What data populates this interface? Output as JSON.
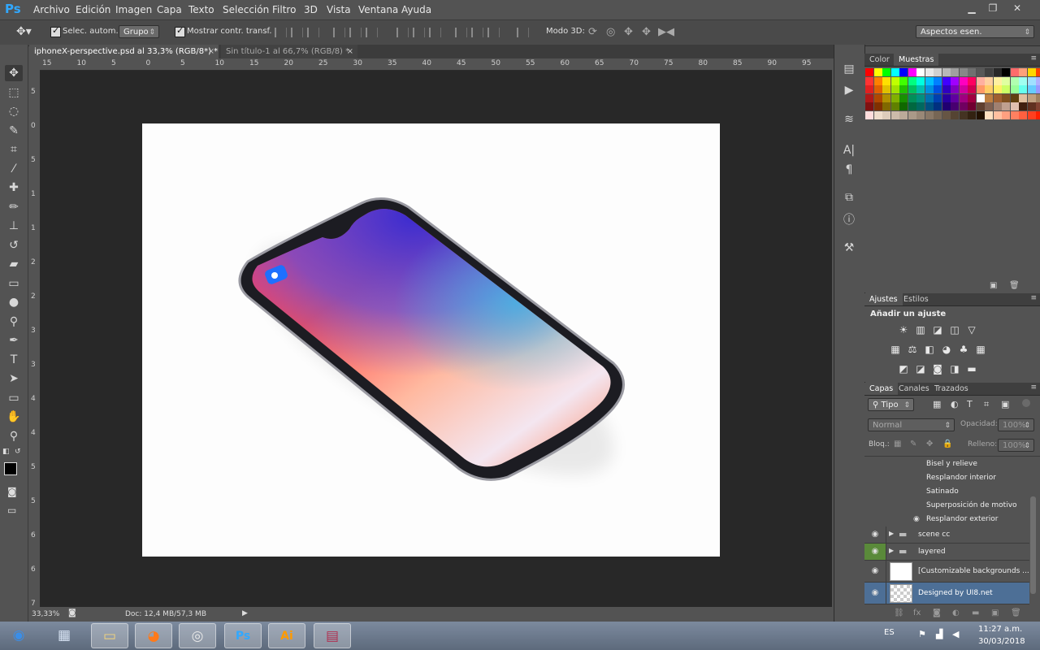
{
  "app": {
    "logo": "Ps"
  },
  "menu": [
    "Archivo",
    "Edición",
    "Imagen",
    "Capa",
    "Texto",
    "Selección",
    "Filtro",
    "3D",
    "Vista",
    "Ventana",
    "Ayuda"
  ],
  "window_controls": {
    "minimize": "▁",
    "restore": "❐",
    "close": "✕"
  },
  "options_bar": {
    "auto_select_label": "Selec. autom.:",
    "auto_select_value": "Grupo",
    "show_transform_label": "Mostrar contr. transf.",
    "mode3d_label": "Modo 3D:",
    "workspace_value": "Aspectos esen."
  },
  "tabs": [
    {
      "label": "iphoneX-perspective.psd al 33,3% (RGB/8*) *",
      "active": true
    },
    {
      "label": "Sin título-1 al 66,7% (RGB/8) *",
      "active": false
    }
  ],
  "ruler_h": [
    "15",
    "10",
    "5",
    "0",
    "5",
    "10",
    "15",
    "20",
    "25",
    "30",
    "35",
    "40",
    "45",
    "50",
    "55",
    "60",
    "65",
    "70",
    "75",
    "80",
    "85",
    "90",
    "95"
  ],
  "ruler_v": [
    "5",
    "0",
    "5",
    "1",
    "1",
    "2",
    "2",
    "3",
    "3",
    "4",
    "4",
    "5",
    "5",
    "6",
    "6",
    "7"
  ],
  "status": {
    "zoom": "33,33%",
    "doc": "Doc: 12,4 MB/57,3 MB"
  },
  "tools": [
    {
      "name": "move-tool-icon",
      "glyph": "✥"
    },
    {
      "name": "marquee-tool-icon",
      "glyph": "⬚"
    },
    {
      "name": "lasso-tool-icon",
      "glyph": "◌"
    },
    {
      "name": "quick-selection-tool-icon",
      "glyph": "✎"
    },
    {
      "name": "crop-tool-icon",
      "glyph": "⌗"
    },
    {
      "name": "eyedropper-tool-icon",
      "glyph": "⁄"
    },
    {
      "name": "healing-brush-tool-icon",
      "glyph": "✚"
    },
    {
      "name": "brush-tool-icon",
      "glyph": "✏"
    },
    {
      "name": "clone-stamp-tool-icon",
      "glyph": "⊥"
    },
    {
      "name": "history-brush-tool-icon",
      "glyph": "↺"
    },
    {
      "name": "eraser-tool-icon",
      "glyph": "▰"
    },
    {
      "name": "gradient-tool-icon",
      "glyph": "▭"
    },
    {
      "name": "blur-tool-icon",
      "glyph": "●"
    },
    {
      "name": "dodge-tool-icon",
      "glyph": "⚲"
    },
    {
      "name": "pen-tool-icon",
      "glyph": "✒"
    },
    {
      "name": "type-tool-icon",
      "glyph": "T"
    },
    {
      "name": "path-selection-tool-icon",
      "glyph": "➤"
    },
    {
      "name": "rectangle-tool-icon",
      "glyph": "▭"
    },
    {
      "name": "hand-tool-icon",
      "glyph": "✋"
    },
    {
      "name": "zoom-tool-icon",
      "glyph": "⚲"
    }
  ],
  "dock_icons": [
    {
      "name": "history-panel-icon",
      "glyph": "▤"
    },
    {
      "name": "actions-panel-icon",
      "glyph": "▶"
    },
    {
      "name": "brush-settings-icon",
      "glyph": "≋"
    },
    {
      "name": "character-panel-icon",
      "glyph": "A|"
    },
    {
      "name": "paragraph-panel-icon",
      "glyph": "¶"
    },
    {
      "name": "clone-source-icon",
      "glyph": "⧉"
    },
    {
      "name": "info-panel-icon",
      "glyph": "ⓘ"
    },
    {
      "name": "tool-presets-icon",
      "glyph": "⚒"
    }
  ],
  "color_panel": {
    "tabs": [
      "Color",
      "Muestras"
    ],
    "active": "Muestras"
  },
  "adjustments_panel": {
    "tabs": [
      "Ajustes",
      "Estilos"
    ],
    "heading": "Añadir un ajuste",
    "icons_row1": [
      "☀",
      "▥",
      "◪",
      "◫",
      "▽"
    ],
    "icons_row2": [
      "▦",
      "⚖",
      "◧",
      "◕",
      "♣",
      "▦"
    ],
    "icons_row3": [
      "◩",
      "◪",
      "◙",
      "◨",
      "▬"
    ]
  },
  "layers_panel": {
    "tabs": [
      "Capas",
      "Canales",
      "Trazados"
    ],
    "filter_label": "Tipo",
    "blend_mode": "Normal",
    "opacity_label": "Opacidad:",
    "opacity_value": "100%",
    "lock_label": "Bloq.:",
    "fill_label": "Relleno:",
    "fill_value": "100%",
    "effects": [
      "Bisel y relieve",
      "Resplandor interior",
      "Satinado",
      "Superposición de motivo",
      "Resplandor exterior"
    ],
    "layers": [
      {
        "name": "scene cc",
        "type": "group",
        "eye_color": "#535353"
      },
      {
        "name": "layered",
        "type": "group",
        "eye_color": "#5a8a3a"
      },
      {
        "name": "[Customizable backgrounds ...",
        "type": "layer",
        "eye_color": "#535353"
      },
      {
        "name": "Designed by UI8.net",
        "type": "layer",
        "eye_color": "#4d6f96"
      }
    ]
  },
  "taskbar": {
    "apps": [
      {
        "name": "start-button",
        "glyph": "◉"
      },
      {
        "name": "calculator-app",
        "glyph": "▦"
      },
      {
        "name": "file-explorer-app",
        "glyph": "▭"
      },
      {
        "name": "firefox-app",
        "glyph": "◕"
      },
      {
        "name": "chrome-app",
        "glyph": "◎"
      },
      {
        "name": "photoshop-app",
        "glyph": "Ps"
      },
      {
        "name": "illustrator-app",
        "glyph": "Ai"
      },
      {
        "name": "winrar-app",
        "glyph": "▤"
      }
    ],
    "lang": "ES",
    "time": "11:27 a.m.",
    "date": "30/03/2018"
  },
  "colors": {
    "swatches": [
      [
        "#ff0000",
        "#ffff00",
        "#00ff00",
        "#00ffff",
        "#0000ff",
        "#ff00ff",
        "#ffffff",
        "#e8e8e8",
        "#d0d0d0",
        "#b8b8b8",
        "#a0a0a0",
        "#888888",
        "#707070",
        "#585858",
        "#404040",
        "#282828",
        "#000000",
        "#ff6b6b",
        "#ffa07a",
        "#ffd700",
        "#ff4500",
        "#ffff66"
      ],
      [
        "#ff3333",
        "#ff8000",
        "#ffe000",
        "#c0ff00",
        "#40ff00",
        "#00ff80",
        "#00ffe0",
        "#00c0ff",
        "#0080ff",
        "#4000ff",
        "#a000ff",
        "#ff00c0",
        "#ff0060",
        "#ffb0a0",
        "#ffd0a0",
        "#fff0a0",
        "#e0ffa0",
        "#b0ffb0",
        "#a0fff0",
        "#a0e0ff",
        "#b0b0ff",
        "#ffa0ff"
      ],
      [
        "#e02020",
        "#e06000",
        "#e0c000",
        "#a0e000",
        "#20c000",
        "#00c060",
        "#00c0b0",
        "#0090e0",
        "#0050e0",
        "#3000c0",
        "#8000c0",
        "#d000a0",
        "#d00050",
        "#ff9966",
        "#ffcc66",
        "#ffee66",
        "#ccff66",
        "#99ff99",
        "#66ffee",
        "#66ccff",
        "#9999ff",
        "#ff99ff"
      ],
      [
        "#b01818",
        "#b04800",
        "#b09000",
        "#80b000",
        "#189000",
        "#00905a",
        "#009080",
        "#0070b0",
        "#0040b0",
        "#2800a0",
        "#6000a0",
        "#a00080",
        "#a00040",
        "#ffffff",
        "#c08040",
        "#a06030",
        "#805020",
        "#604010",
        "#e0c0a0",
        "#c0a080",
        "#a08060",
        "#806040"
      ],
      [
        "#801010",
        "#803000",
        "#806800",
        "#608000",
        "#106800",
        "#006840",
        "#006860",
        "#005080",
        "#003080",
        "#200070",
        "#480070",
        "#700060",
        "#700030",
        "#604030",
        "#806050",
        "#a08070",
        "#c0a090",
        "#e0c0b0",
        "#402010",
        "#603020",
        "#804030",
        "#a05040"
      ],
      [
        "#ffdddd",
        "#eeddcc",
        "#ddccbb",
        "#ccbbaa",
        "#bbaa99",
        "#aa9988",
        "#998877",
        "#887766",
        "#776655",
        "#665544",
        "#554433",
        "#443322",
        "#332211",
        "#221100",
        "#ffe0c0",
        "#ffc0a0",
        "#ffa080",
        "#ff8060",
        "#ff6040",
        "#ff4020",
        "#ff2000",
        "#e01000"
      ]
    ]
  }
}
